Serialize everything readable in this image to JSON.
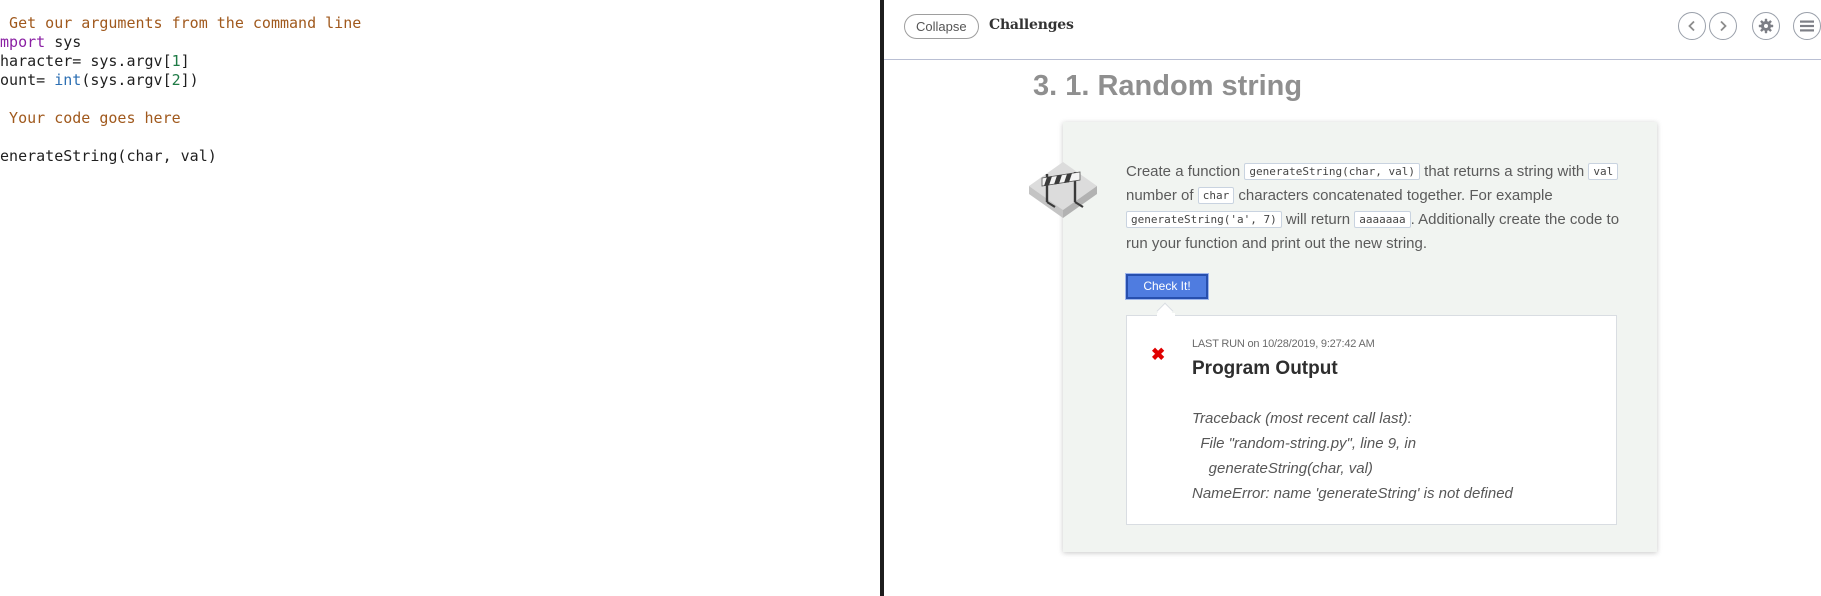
{
  "editor": {
    "lines": [
      [
        {
          "t": "# Get our arguments from the command line",
          "c": "comment"
        }
      ],
      [
        {
          "t": "import",
          "c": "kw"
        },
        {
          "t": " sys",
          "c": "plain"
        }
      ],
      [
        {
          "t": "character= sys.argv[",
          "c": "plain"
        },
        {
          "t": "1",
          "c": "num"
        },
        {
          "t": "]",
          "c": "plain"
        }
      ],
      [
        {
          "t": "count= ",
          "c": "plain"
        },
        {
          "t": "int",
          "c": "builtin"
        },
        {
          "t": "(sys.argv[",
          "c": "plain"
        },
        {
          "t": "2",
          "c": "num"
        },
        {
          "t": "])",
          "c": "plain"
        }
      ],
      [],
      [
        {
          "t": "# Your code goes here",
          "c": "comment"
        }
      ],
      [],
      [
        {
          "t": "generateString(char, val)",
          "c": "plain"
        }
      ]
    ]
  },
  "topbar": {
    "collapse_label": "Collapse",
    "section_label": "Challenges",
    "buttons": [
      {
        "name": "previous-button",
        "icon": "chevron-left-icon"
      },
      {
        "name": "next-button",
        "icon": "chevron-right-icon"
      },
      {
        "name": "settings-button",
        "icon": "gear-icon"
      },
      {
        "name": "menu-button",
        "icon": "menu-icon"
      }
    ]
  },
  "challenge": {
    "title": "3. 1. Random string",
    "description": [
      {
        "t": "Create a function "
      },
      {
        "t": "generateString(char, val)",
        "code": true
      },
      {
        "t": " that returns a string with "
      },
      {
        "t": "val",
        "code": true
      },
      {
        "t": " number of "
      },
      {
        "t": "char",
        "code": true
      },
      {
        "t": " characters concatenated together. For example "
      },
      {
        "t": "generateString('a', 7)",
        "code": true
      },
      {
        "t": " will return "
      },
      {
        "t": "aaaaaaa",
        "code": true
      },
      {
        "t": ". Additionally create the code to run your function and print out the new string."
      }
    ],
    "check_label": "Check It!",
    "result": {
      "status_icon": "✖",
      "status_icon_name": "error-x-icon",
      "last_run": "LAST RUN on 10/28/2019, 9:27:42 AM",
      "heading": "Program Output",
      "output_lines": [
        "Traceback (most recent call last):",
        "  File \"random-string.py\", line 9, in",
        "    generateString(char, val)",
        "NameError: name 'generateString' is not defined"
      ]
    }
  },
  "colors": {
    "error": "#e00000",
    "check_button": "#4f7ce0",
    "card_background": "#f1f4f1",
    "code_comment": "#a0591d",
    "code_keyword": "#8a1fa3",
    "code_builtin": "#2d6fb3",
    "code_number": "#1e7a45"
  }
}
